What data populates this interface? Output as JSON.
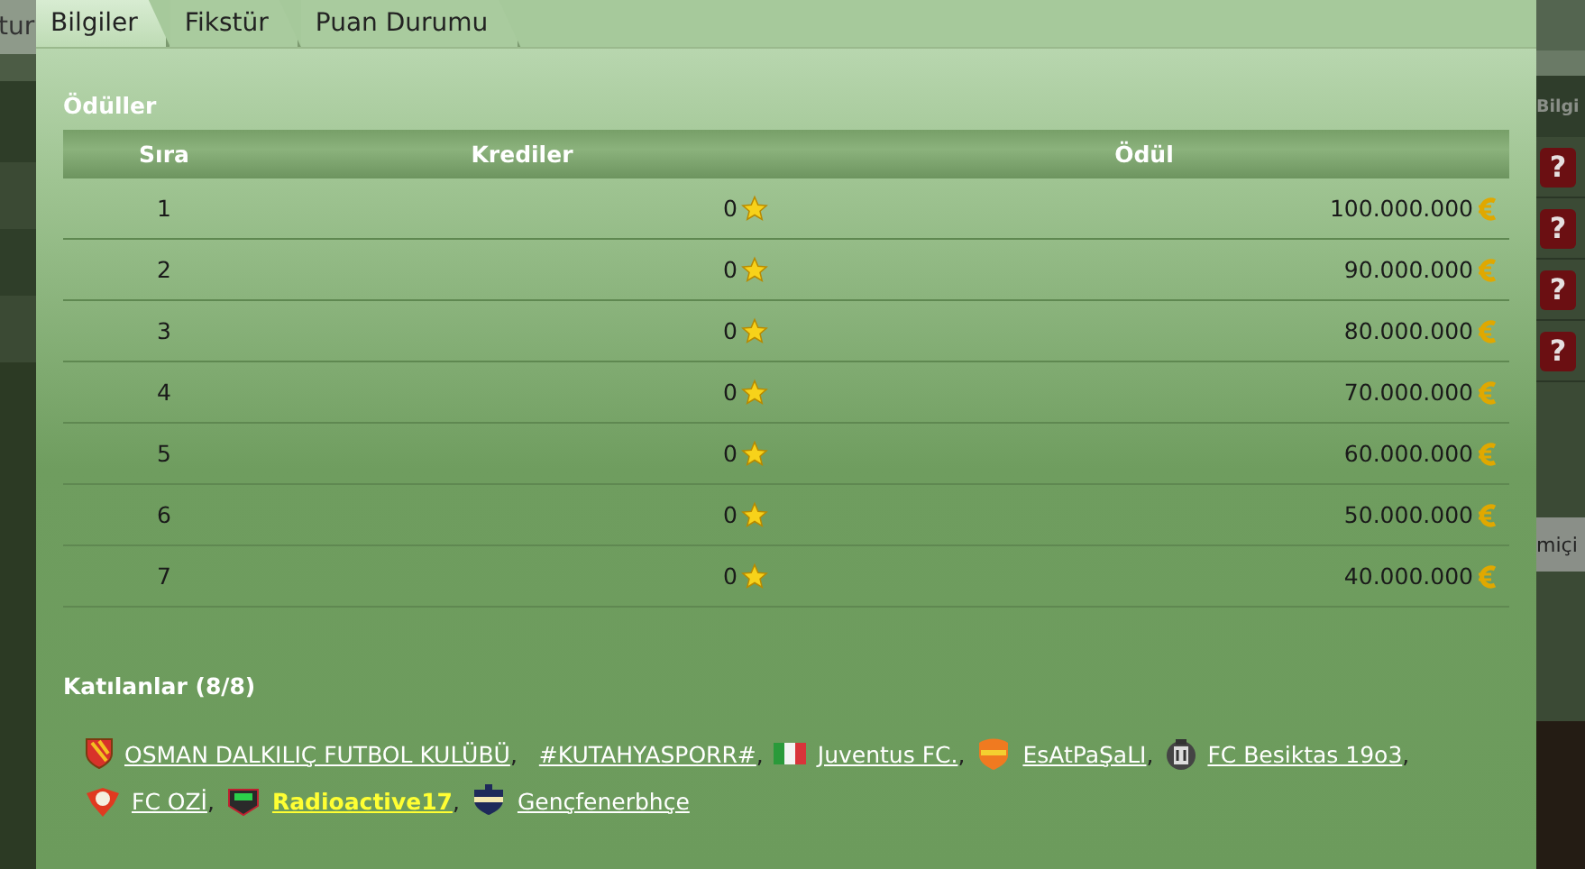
{
  "background": {
    "left_label": "tur",
    "right_header": "Bilgi",
    "help_buttons": [
      "?",
      "?",
      "?",
      "?"
    ],
    "right_bottom_label": "miçi"
  },
  "tabs": [
    {
      "label": "Bilgiler",
      "selected": true
    },
    {
      "label": "Fikstür",
      "selected": false
    },
    {
      "label": "Puan Durumu",
      "selected": false
    }
  ],
  "prizes": {
    "title": "Ödüller",
    "columns": [
      "Sıra",
      "Krediler",
      "Ödül"
    ],
    "rows": [
      {
        "rank": "1",
        "credits": "0",
        "prize": "100.000.000"
      },
      {
        "rank": "2",
        "credits": "0",
        "prize": "90.000.000"
      },
      {
        "rank": "3",
        "credits": "0",
        "prize": "80.000.000"
      },
      {
        "rank": "4",
        "credits": "0",
        "prize": "70.000.000"
      },
      {
        "rank": "5",
        "credits": "0",
        "prize": "60.000.000"
      },
      {
        "rank": "6",
        "credits": "0",
        "prize": "50.000.000"
      },
      {
        "rank": "7",
        "credits": "0",
        "prize": "40.000.000"
      }
    ]
  },
  "participants": {
    "title": "Katılanlar (8/8)",
    "items": [
      {
        "name": "OSMAN DALKILIÇ FUTBOL KULÜBÜ",
        "kind": "red",
        "highlighted": false,
        "separator": ","
      },
      {
        "name": "#KUTAHYASPORR#",
        "kind": "plain",
        "highlighted": false,
        "separator": ","
      },
      {
        "name": "Juventus FC.",
        "kind": "flag",
        "highlighted": false,
        "separator": ","
      },
      {
        "name": "EsAtPaŞaLI",
        "kind": "orange",
        "highlighted": false,
        "separator": ","
      },
      {
        "name": "FC Besiktas 19o3",
        "kind": "grey",
        "highlighted": false,
        "separator": ","
      },
      {
        "name": "FC OZİ",
        "kind": "wings",
        "highlighted": false,
        "separator": ","
      },
      {
        "name": "Radioactive17",
        "kind": "dark",
        "highlighted": true,
        "separator": ","
      },
      {
        "name": "Gençfenerbhçe",
        "kind": "navy",
        "highlighted": false
      }
    ]
  }
}
